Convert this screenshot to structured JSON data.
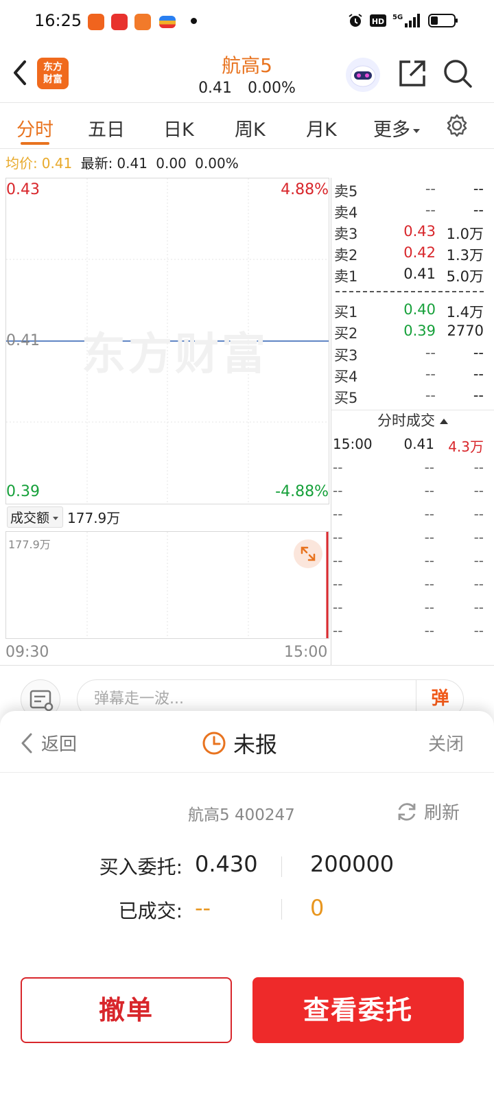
{
  "status_bar": {
    "time": "16:25",
    "right_icons": [
      "alarm-icon",
      "hd-icon",
      "5g-signal-icon",
      "battery-icon"
    ]
  },
  "header": {
    "logo_text_1": "东方",
    "logo_text_2": "财富",
    "stock_name": "航高5",
    "price": "0.41",
    "change_pct": "0.00%"
  },
  "tabs": [
    {
      "label": "分时",
      "active": true
    },
    {
      "label": "五日"
    },
    {
      "label": "日K"
    },
    {
      "label": "周K"
    },
    {
      "label": "月K"
    },
    {
      "label": "更多"
    }
  ],
  "summary": {
    "avg_label": "均价:",
    "avg_value": "0.41",
    "latest_label": "最新:",
    "latest_value": "0.41",
    "change": "0.00",
    "change_pct": "0.00%"
  },
  "chart": {
    "price_high": "0.43",
    "price_mid": "0.41",
    "price_low": "0.39",
    "pct_high": "4.88%",
    "pct_low": "-4.88%",
    "watermark": "东方财富",
    "volume_selector": "成交额",
    "volume_value": "177.9万",
    "volume_max": "177.9万",
    "time_start": "09:30",
    "time_end": "15:00",
    "colors": {
      "up": "#d8262b",
      "down": "#16a03a",
      "line": "#2a5db0"
    }
  },
  "chart_data": {
    "type": "line",
    "x": [
      "09:30",
      "15:00"
    ],
    "series": [
      {
        "values": [
          0.41,
          0.41
        ]
      }
    ],
    "ylim": [
      0.39,
      0.43
    ],
    "grid": true
  },
  "order_book": {
    "asks": [
      {
        "label": "卖5",
        "price": "--",
        "volume": "--",
        "color": "dash"
      },
      {
        "label": "卖4",
        "price": "--",
        "volume": "--",
        "color": "dash"
      },
      {
        "label": "卖3",
        "price": "0.43",
        "volume": "1.0万",
        "color": "red"
      },
      {
        "label": "卖2",
        "price": "0.42",
        "volume": "1.3万",
        "color": "red"
      },
      {
        "label": "卖1",
        "price": "0.41",
        "volume": "5.0万",
        "color": "plain"
      }
    ],
    "bids": [
      {
        "label": "买1",
        "price": "0.40",
        "volume": "1.4万",
        "color": "green"
      },
      {
        "label": "买2",
        "price": "0.39",
        "volume": "2770",
        "color": "green"
      },
      {
        "label": "买3",
        "price": "--",
        "volume": "--",
        "color": "dash"
      },
      {
        "label": "买4",
        "price": "--",
        "volume": "--",
        "color": "dash"
      },
      {
        "label": "买5",
        "price": "--",
        "volume": "--",
        "color": "dash"
      }
    ],
    "ticks_title": "分时成交",
    "ticks": [
      {
        "time": "15:00",
        "price": "0.41",
        "volume": "4.3万"
      },
      {
        "time": "--",
        "price": "--",
        "volume": "--"
      },
      {
        "time": "--",
        "price": "--",
        "volume": "--"
      },
      {
        "time": "--",
        "price": "--",
        "volume": "--"
      },
      {
        "time": "--",
        "price": "--",
        "volume": "--"
      },
      {
        "time": "--",
        "price": "--",
        "volume": "--"
      },
      {
        "time": "--",
        "price": "--",
        "volume": "--"
      },
      {
        "time": "--",
        "price": "--",
        "volume": "--"
      },
      {
        "time": "--",
        "price": "--",
        "volume": "--"
      }
    ]
  },
  "danmu": {
    "placeholder": "弹幕走一波...",
    "send_label": "弹"
  },
  "order_panel": {
    "back_label": "返回",
    "status": "未报",
    "close_label": "关闭",
    "stock": "航高5 400247",
    "refresh_label": "刷新",
    "buy_label": "买入委托:",
    "buy_price": "0.430",
    "buy_quantity": "200000",
    "filled_label": "已成交:",
    "filled_price": "--",
    "filled_quantity": "0",
    "cancel_button": "撤单",
    "view_button": "查看委托"
  }
}
